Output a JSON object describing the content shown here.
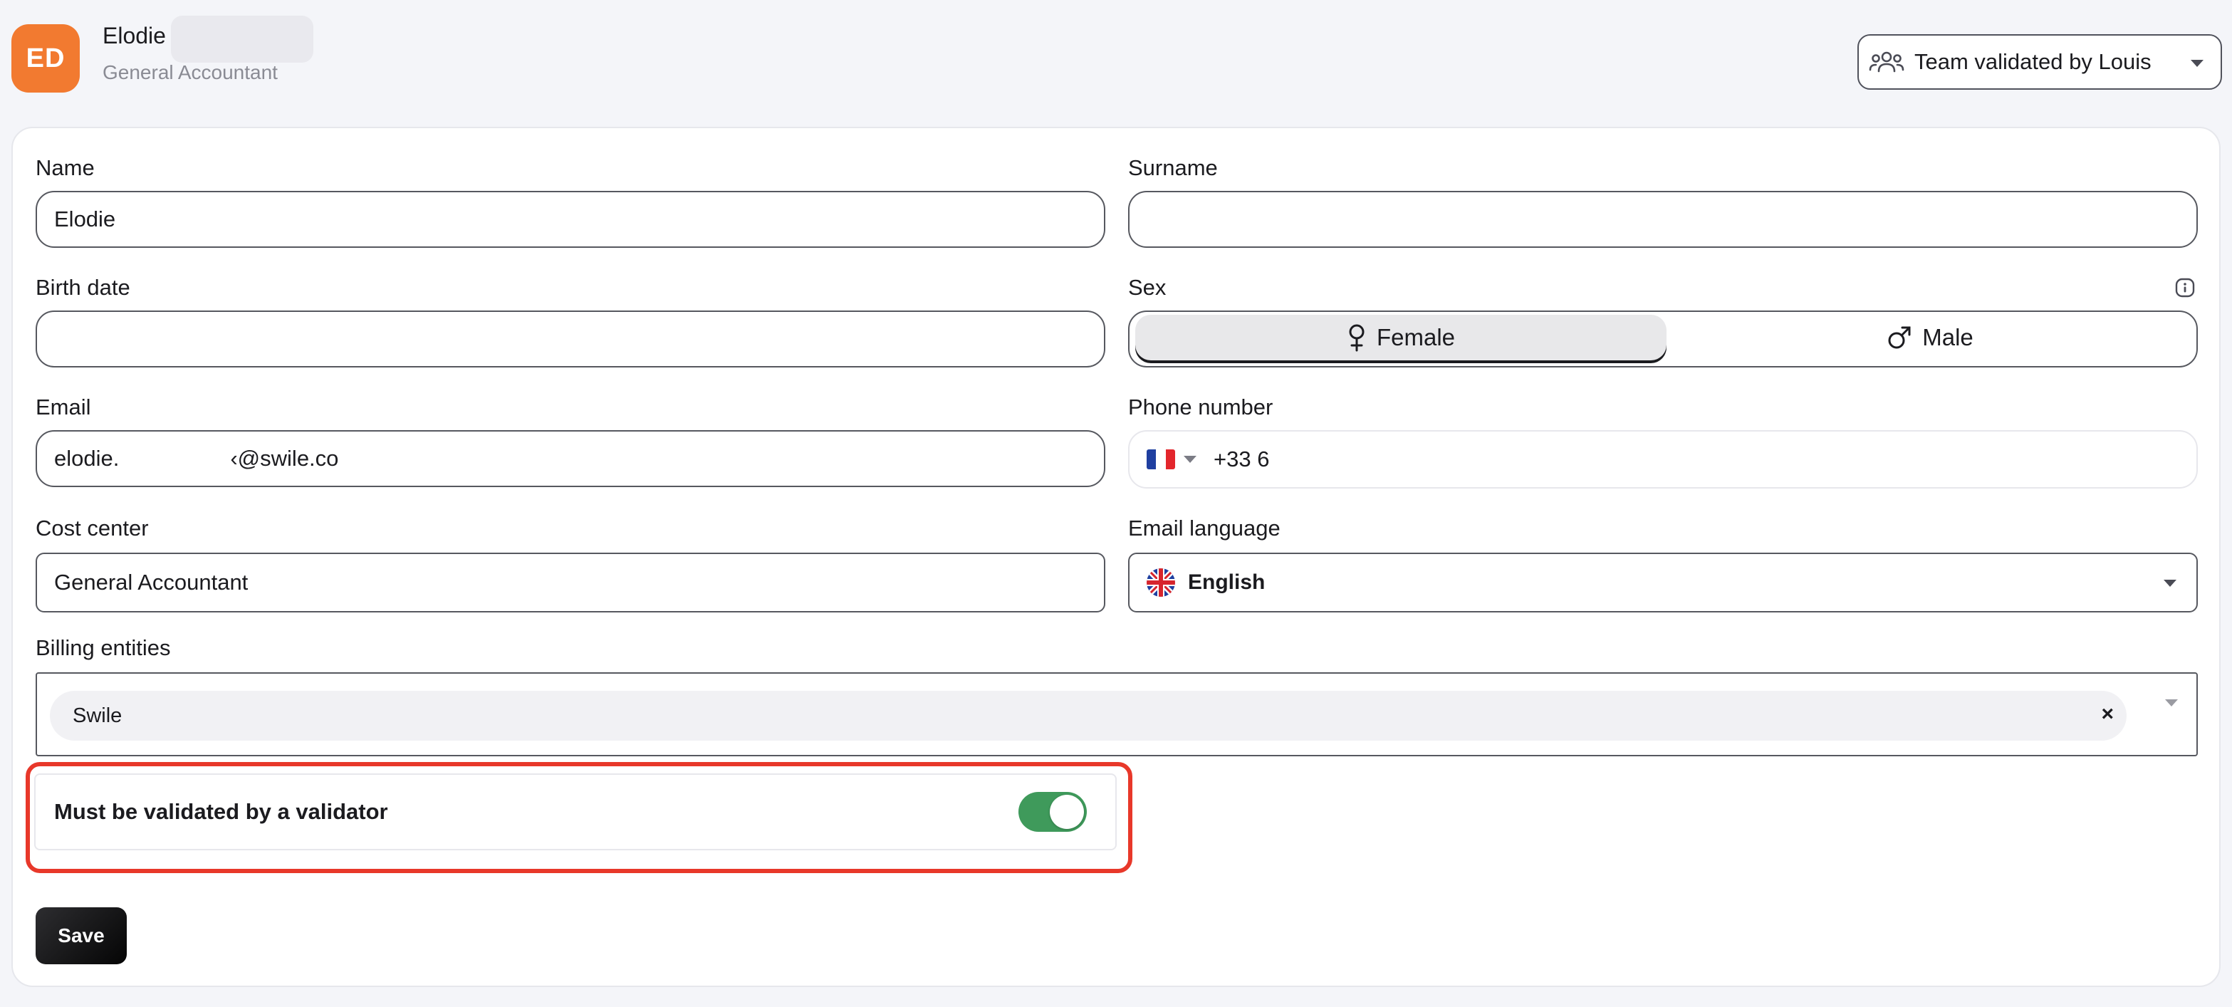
{
  "header": {
    "avatar_initials": "ED",
    "user_name": "Elodie",
    "user_role": "General Accountant",
    "team_select": {
      "value": "Team validated by Louis",
      "icon": "users-group-icon"
    }
  },
  "form": {
    "name": {
      "label": "Name",
      "value": "Elodie"
    },
    "surname": {
      "label": "Surname",
      "value": ""
    },
    "birth_date": {
      "label": "Birth date",
      "value": ""
    },
    "sex": {
      "label": "Sex",
      "info_icon": "info-icon",
      "options": [
        {
          "label": "Female",
          "icon": "female-icon",
          "selected": true
        },
        {
          "label": "Male",
          "icon": "male-icon",
          "selected": false
        }
      ]
    },
    "email": {
      "label": "Email",
      "value_prefix": "elodie.",
      "value_suffix": "‹@swile.co"
    },
    "phone": {
      "label": "Phone number",
      "country": "FR",
      "value": "+33 6"
    },
    "cost_center": {
      "label": "Cost center",
      "value": "General Accountant"
    },
    "email_language": {
      "label": "Email language",
      "value": "English",
      "flag": "uk-flag-icon"
    },
    "billing_entities": {
      "label": "Billing entities",
      "chips": [
        "Swile"
      ],
      "chip_remove": "×"
    },
    "validator": {
      "label": "Must be validated by a validator",
      "enabled": true
    }
  },
  "actions": {
    "save_label": "Save"
  },
  "colors": {
    "avatar": "#f27a30",
    "toggle_on": "#3f9a5b",
    "highlight": "#e8382a",
    "save_button": "#0b0b0c"
  }
}
